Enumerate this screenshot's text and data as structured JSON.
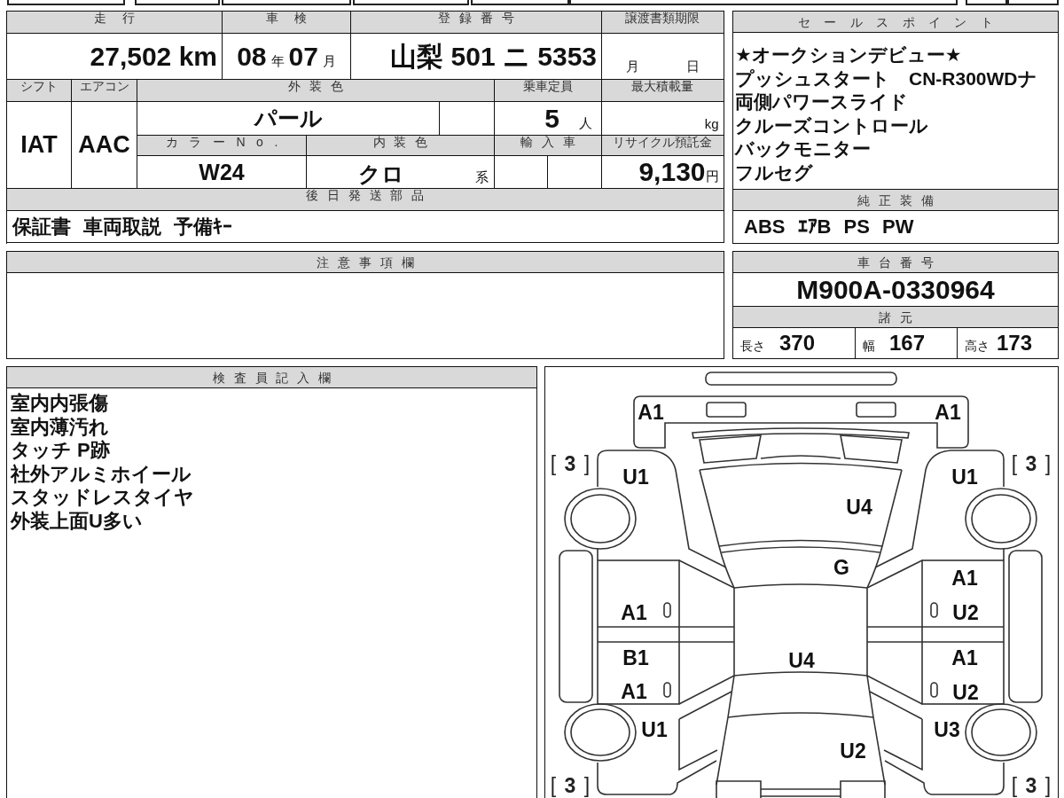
{
  "vehicle_info": {
    "mileage": {
      "label": "走行",
      "value": "27,502 km"
    },
    "inspection": {
      "label": "車検",
      "year": "08",
      "year_unit": "年",
      "month": "07",
      "month_unit": "月"
    },
    "registration": {
      "label": "登録番号",
      "value": "山梨 501 ニ 5353"
    },
    "transfer_deadline": {
      "label": "譲渡書類期限",
      "month_unit": "月",
      "day_unit": "日"
    },
    "shift": {
      "label": "シフト",
      "value": "IAT"
    },
    "air_conditioning": {
      "label": "エアコン",
      "value": "AAC"
    },
    "exterior_color": {
      "label": "外装色",
      "value": "パール"
    },
    "capacity": {
      "label": "乗車定員",
      "value": "5",
      "unit": "人"
    },
    "max_load": {
      "label": "最大積載量",
      "unit": "kg"
    },
    "color_no": {
      "label": "カラーNo.",
      "value": "W24"
    },
    "interior_color": {
      "label": "内装色",
      "value": "クロ",
      "suffix": "系"
    },
    "imported": {
      "label": "輸入車"
    },
    "recycling_fee": {
      "label": "リサイクル預託金",
      "value": "9,130",
      "unit": "円"
    },
    "parts_to_follow": {
      "label": "後日発送部品",
      "value": "保証書 車両取説 予備ｷｰ"
    }
  },
  "sales_points": {
    "title": "セールスポイント",
    "lines": [
      "★オークションデビュー★",
      "プッシュスタート　CN-R300WDナ",
      "両側パワースライド",
      "クルーズコントロール",
      "バックモニター",
      "フルセグ"
    ]
  },
  "standard_equipment": {
    "title": "純正装備",
    "value": "ABS ｴｱB PS PW"
  },
  "notes": {
    "title": "注意事項欄"
  },
  "chassis": {
    "title": "車台番号",
    "value": "M900A-0330964"
  },
  "specs": {
    "title": "諸元",
    "items": [
      {
        "label": "長さ",
        "value": "370"
      },
      {
        "label": "幅",
        "value": "167"
      },
      {
        "label": "高さ",
        "value": "173"
      }
    ]
  },
  "inspector_notes": {
    "title": "検査員記入欄",
    "lines": [
      "室内内張傷",
      "室内薄汚れ",
      "タッチ P跡",
      "社外アルミホイール",
      "スタッドレスタイヤ",
      "外装上面U多い"
    ]
  },
  "inspection_diagram": {
    "marks": [
      {
        "kind": "damage",
        "code": "A1"
      },
      {
        "kind": "damage",
        "code": "A1"
      },
      {
        "kind": "tire",
        "code": "[ **3** ]"
      },
      {
        "kind": "tire",
        "code": "[ **3** ]"
      },
      {
        "kind": "damage",
        "code": "U1"
      },
      {
        "kind": "damage",
        "code": "U1"
      },
      {
        "kind": "damage",
        "code": "U4"
      },
      {
        "kind": "damage",
        "code": "G"
      },
      {
        "kind": "damage",
        "code": "A1"
      },
      {
        "kind": "damage",
        "code": "A1"
      },
      {
        "kind": "damage",
        "code": "U2"
      },
      {
        "kind": "damage",
        "code": "B1"
      },
      {
        "kind": "damage",
        "code": "U4"
      },
      {
        "kind": "damage",
        "code": "A1"
      },
      {
        "kind": "damage",
        "code": "A1"
      },
      {
        "kind": "damage",
        "code": "U2"
      },
      {
        "kind": "damage",
        "code": "U1"
      },
      {
        "kind": "damage",
        "code": "U3"
      },
      {
        "kind": "damage",
        "code": "U2"
      },
      {
        "kind": "tire",
        "code": "[ **3** ]"
      },
      {
        "kind": "tire",
        "code": "[ **3** ]"
      }
    ]
  }
}
